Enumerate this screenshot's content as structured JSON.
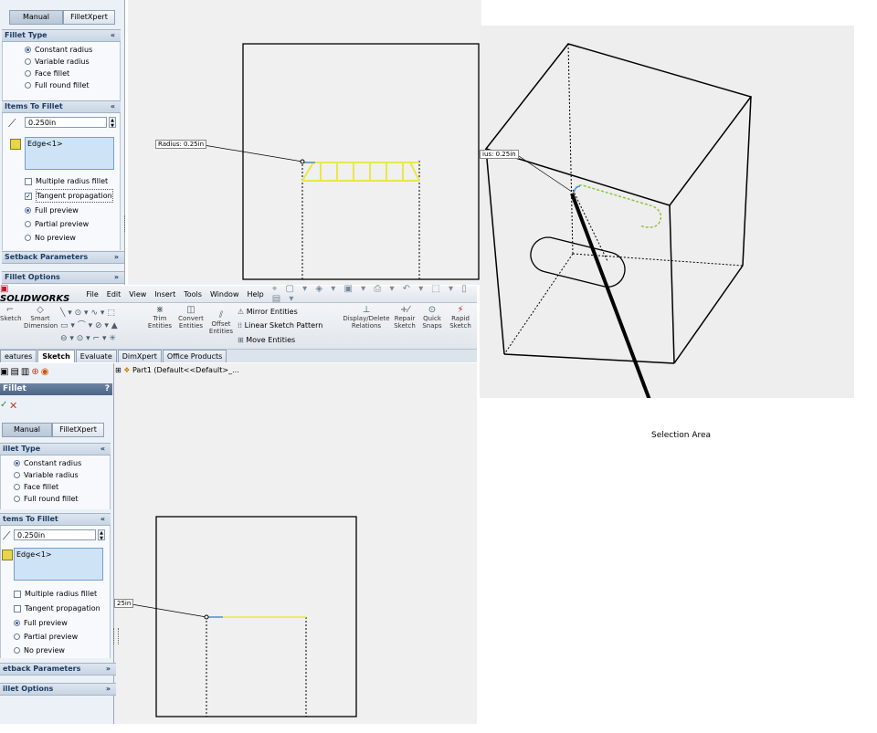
{
  "top_panel": {
    "tabs": [
      "Manual",
      "FilletXpert"
    ],
    "fillet_type_header": "Fillet Type",
    "fillet_type_options": [
      "Constant radius",
      "Variable radius",
      "Face fillet",
      "Full round fillet"
    ],
    "items_header": "Items To Fillet",
    "radius_value": "0.250in",
    "edge_item": "Edge<1>",
    "checkbox_multiple": "Multiple radius fillet",
    "checkbox_tangent": "Tangent propagation",
    "preview_options": [
      "Full preview",
      "Partial preview",
      "No preview"
    ],
    "setback_header": "Setback Parameters",
    "options_header": "Fillet Options"
  },
  "top_view": {
    "radius_callout": "Radius: 0.25in"
  },
  "iso_view": {
    "radius_callout": "ius: 0.25in",
    "annotation": "Selection Area"
  },
  "app": {
    "logo": "SOLIDWORKS",
    "menu": [
      "File",
      "Edit",
      "View",
      "Insert",
      "Tools",
      "Window",
      "Help"
    ],
    "tools": [
      {
        "label": "Sketch",
        "icon": "sketch-icon"
      },
      {
        "label": "Smart Dimension",
        "icon": "dimension-icon"
      },
      {
        "label": "Trim Entities",
        "icon": "trim-icon"
      },
      {
        "label": "Convert Entities",
        "icon": "convert-icon"
      },
      {
        "label": "Offset Entities",
        "icon": "offset-icon"
      },
      {
        "label": "Display/Delete Relations",
        "icon": "relations-icon"
      },
      {
        "label": "Repair Sketch",
        "icon": "repair-icon"
      },
      {
        "label": "Quick Snaps",
        "icon": "snaps-icon"
      },
      {
        "label": "Rapid Sketch",
        "icon": "rapid-sketch-icon"
      }
    ],
    "mirror_entities": "Mirror Entities",
    "linear_pattern": "Linear Sketch Pattern",
    "move_entities": "Move Entities",
    "command_tabs": [
      "eatures",
      "Sketch",
      "Evaluate",
      "DimXpert",
      "Office Products"
    ],
    "tree_root": "Part1  (Default<<Default>_..."
  },
  "bottom_panel": {
    "title": "Fillet",
    "help": "?",
    "tabs": [
      "Manual",
      "FilletXpert"
    ],
    "fillet_type_header": "illet Type",
    "fillet_type_options": [
      "Constant radius",
      "Variable radius",
      "Face fillet",
      "Full round fillet"
    ],
    "items_header": "tems To Fillet",
    "radius_value": "0.250in",
    "edge_item": "Edge<1>",
    "checkbox_multiple": "Multiple radius fillet",
    "checkbox_tangent": "Tangent propagation",
    "preview_options": [
      "Full preview",
      "Partial preview",
      "No preview"
    ],
    "setback_header": "etback Parameters",
    "options_header": "illet Options"
  },
  "bottom_view": {
    "radius_callout": "25in"
  },
  "colors": {
    "preview_yellow": "#e8e84a",
    "selected_blue": "#4a8fd6",
    "edge_green": "#8dc63f",
    "panel_bg": "#ecf1f7"
  }
}
